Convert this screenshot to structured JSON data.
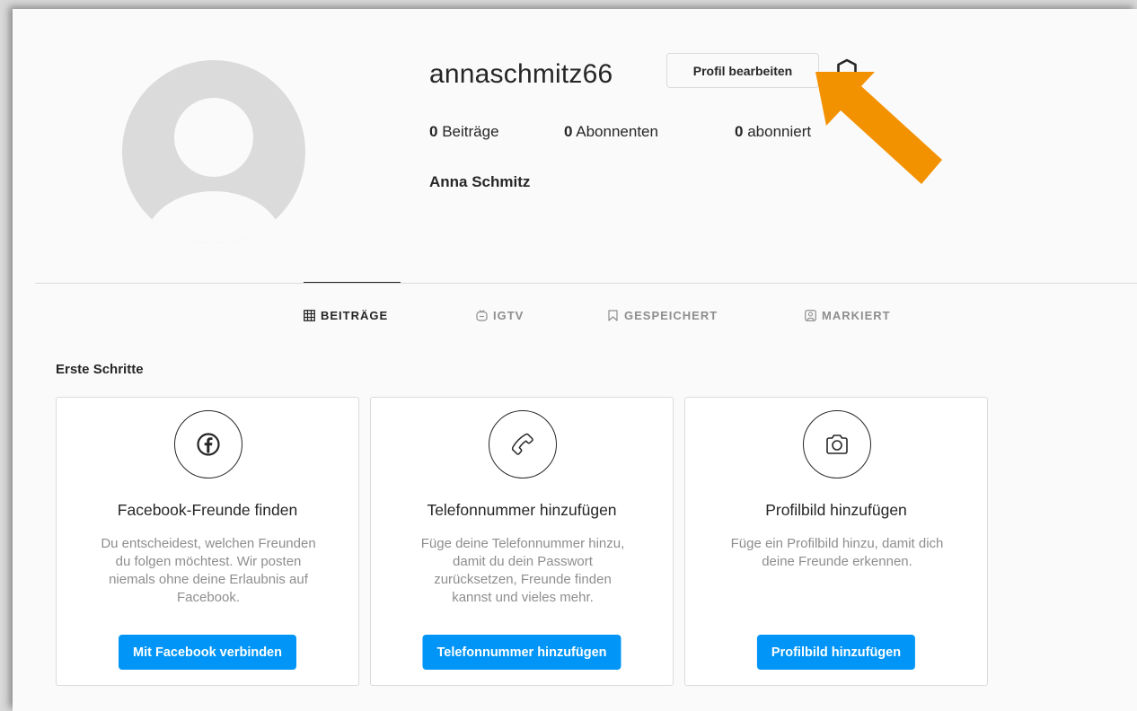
{
  "profile": {
    "username": "annaschmitz66",
    "edit_label": "Profil bearbeiten",
    "full_name": "Anna Schmitz",
    "stats": [
      {
        "count": "0",
        "label": "Beiträge"
      },
      {
        "count": "0",
        "label": "Abonnenten"
      },
      {
        "count": "0",
        "label": "abonniert"
      }
    ]
  },
  "tabs": [
    {
      "label": "BEITRÄGE",
      "icon": "grid-icon",
      "active": true
    },
    {
      "label": "IGTV",
      "icon": "igtv-icon",
      "active": false
    },
    {
      "label": "GESPEICHERT",
      "icon": "bookmark-icon",
      "active": false
    },
    {
      "label": "MARKIERT",
      "icon": "tagged-icon",
      "active": false
    }
  ],
  "getting_started": {
    "title": "Erste Schritte",
    "cards": [
      {
        "icon": "facebook-icon",
        "title": "Facebook-Freunde finden",
        "desc_lines": [
          "Du entscheidest, welchen Freunden",
          "du folgen möchtest. Wir posten",
          "niemals ohne deine Erlaubnis auf",
          "Facebook."
        ],
        "button": "Mit Facebook verbinden"
      },
      {
        "icon": "phone-icon",
        "title": "Telefonnummer hinzufügen",
        "desc_lines": [
          "Füge deine Telefonnummer hinzu,",
          "damit du dein Passwort",
          "zurücksetzen, Freunde finden",
          "kannst und vieles mehr."
        ],
        "button": "Telefonnummer hinzufügen"
      },
      {
        "icon": "camera-icon",
        "title": "Profilbild hinzufügen",
        "desc_lines": [
          "Füge ein Profilbild hinzu, damit dich",
          "deine Freunde erkennen."
        ],
        "button": "Profilbild hinzufügen"
      }
    ]
  },
  "colors": {
    "accent": "#0095f6",
    "arrow": "#f39200",
    "text": "#262626",
    "muted": "#8e8e8e"
  }
}
